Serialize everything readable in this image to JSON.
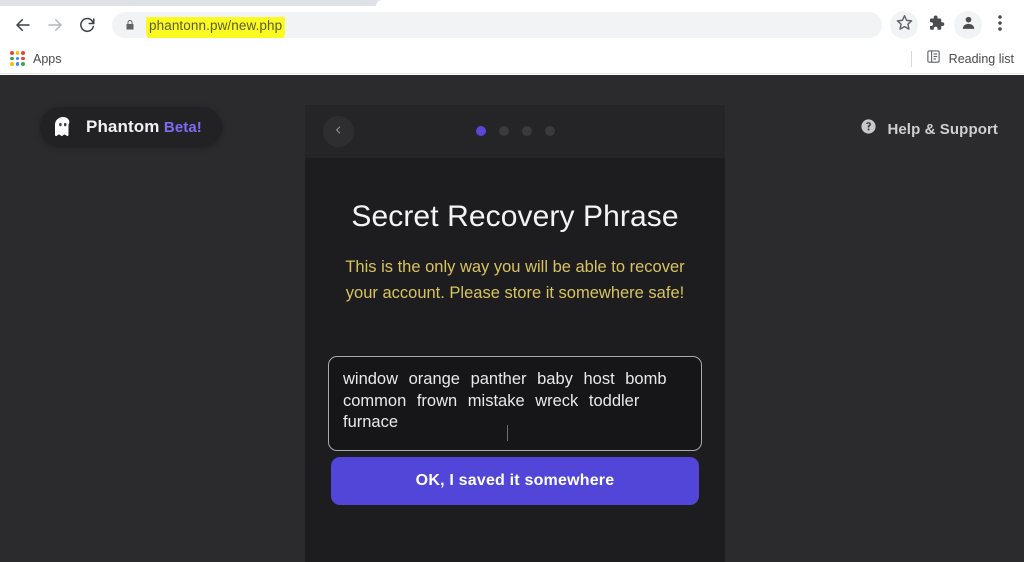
{
  "browser": {
    "nav": {
      "back_icon": "arrow-left-icon",
      "forward_icon": "arrow-right-icon",
      "reload_icon": "reload-icon"
    },
    "omnibox": {
      "lock_icon": "lock-icon",
      "url": "phantonn.pw/new.php",
      "highlight_color": "#fbfb21"
    },
    "toolbar_icons": [
      {
        "name": "bookmark-star-icon",
        "label": "Bookmark this tab"
      },
      {
        "name": "extensions-puzzle-icon",
        "label": "Extensions"
      },
      {
        "name": "profile-avatar-icon",
        "label": "Profile"
      },
      {
        "name": "more-menu-icon",
        "label": "Customize and control Google Chrome"
      }
    ],
    "bookmarks": {
      "apps_icon": "apps-grid-icon",
      "apps_label": "Apps",
      "reading_list_icon": "reading-list-icon",
      "reading_list_label": "Reading list"
    }
  },
  "page": {
    "background_color": "#2b2b2d",
    "brand": {
      "icon": "ghost-icon",
      "name": "Phantom",
      "beta": "Beta!",
      "beta_color": "#7b6cf0"
    },
    "help": {
      "icon": "question-circle-icon",
      "label": "Help & Support"
    },
    "modal": {
      "back_icon": "chevron-left-icon",
      "pagination": {
        "total": 4,
        "active_index": 0,
        "active_color": "#5a47d6",
        "inactive_color": "#3a3a3c"
      },
      "title": "Secret Recovery Phrase",
      "warning": "This is the only way you will be able to recover your account. Please store it somewhere safe!",
      "warning_color": "#d8c35f",
      "seed_phrase": {
        "words": [
          "window",
          "orange",
          "panther",
          "baby",
          "host",
          "bomb",
          "common",
          "frown",
          "mistake",
          "wreck",
          "toddler",
          "furnace"
        ],
        "text": "window  orange  panther  baby  host bomb  common  frown  mistake  wreck toddler  furnace"
      },
      "cta_label": "OK, I saved it somewhere",
      "cta_color": "#5146d8"
    }
  }
}
